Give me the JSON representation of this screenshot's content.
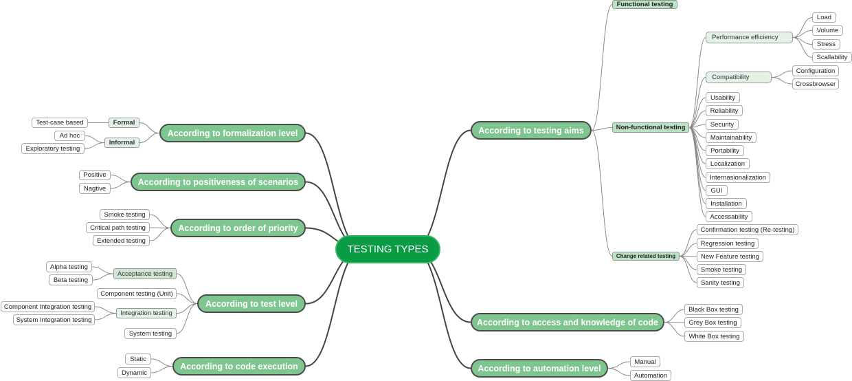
{
  "root": {
    "label": "TESTING TYPES",
    "color": "#0a9b45"
  },
  "colors": {
    "main_fill": "#7fc58f",
    "sub_fill": "#bde1c4",
    "sub2_fill": "#e3f1e6",
    "leaf_fill": "#ffffff",
    "link": "#444444"
  },
  "branches": {
    "testing_aims": {
      "label": "According to testing aims",
      "functional": "Functional testing",
      "non_functional": {
        "label": "Non-functional testing",
        "performance": {
          "label": "Performance efficiency",
          "items": [
            "Load",
            "Volume",
            "Stress",
            "Scallability"
          ]
        },
        "compatibility": {
          "label": "Compatibility",
          "items": [
            "Configuration",
            "Crossbrowser"
          ]
        },
        "items": [
          "Usability",
          "Reliability",
          "Security",
          "Maintainability",
          "Portability",
          "Localization",
          "Internasionalization",
          "GUI",
          "Installation",
          "Accessability"
        ]
      },
      "change_related": {
        "label": "Change related testing",
        "items": [
          "Confirmation testing (Re-testing)",
          "Regression testing",
          "New Feature testing",
          "Smoke testing",
          "Sanity testing"
        ]
      }
    },
    "access_knowledge": {
      "label": "According to access and knowledge of code",
      "items": [
        "Black Box testing",
        "Grey Box testing",
        "White Box testing"
      ]
    },
    "automation": {
      "label": "According to automation level",
      "items": [
        "Manual",
        "Automation"
      ]
    },
    "formalization": {
      "label": "According to formalization level",
      "formal": {
        "label": "Formal",
        "items": [
          "Test-case based"
        ]
      },
      "informal": {
        "label": "Informal",
        "items": [
          "Ad hoc",
          "Exploratory testing"
        ]
      }
    },
    "positiveness": {
      "label": "According to positiveness of scenarios",
      "items": [
        "Positive",
        "Nagtive"
      ]
    },
    "priority": {
      "label": "According to order of priority",
      "items": [
        "Smoke testing",
        "Critical path testing",
        "Extended testing"
      ]
    },
    "test_level": {
      "label": "According to test level",
      "acceptance": {
        "label": "Acceptance testing",
        "items": [
          "Alpha testing",
          "Beta testing"
        ]
      },
      "component": "Component testing (Unit)",
      "integration": {
        "label": "Integration testing",
        "items": [
          "Component Integration testing",
          "System Integration testing"
        ]
      },
      "system": "System testing"
    },
    "code_execution": {
      "label": "According to code execution",
      "items": [
        "Static",
        "Dynamic"
      ]
    }
  }
}
